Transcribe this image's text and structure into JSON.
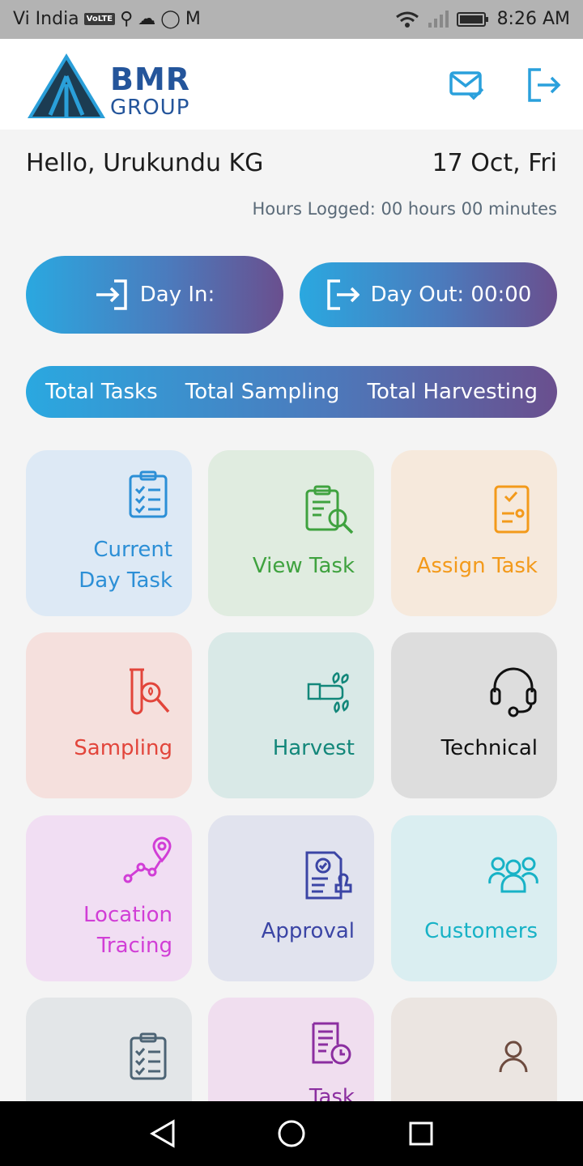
{
  "status_bar": {
    "carrier": "Vi India",
    "volte": "VoLTE",
    "time": "8:26 AM"
  },
  "header": {
    "logo_line1": "BMR",
    "logo_line2": "GROUP"
  },
  "greeting": "Hello, Urukundu KG",
  "date": "17 Oct, Fri",
  "hours_logged": "Hours Logged: 00 hours 00 minutes",
  "day_in_label": "Day In:",
  "day_out_label": "Day Out: 00:00",
  "totals": {
    "tasks": "Total Tasks",
    "sampling": "Total Sampling",
    "harvesting": "Total Harvesting"
  },
  "tiles": [
    {
      "line1": "Current",
      "line2": "Day Task",
      "bg": "#dde9f5",
      "color": "#2c8fd6",
      "icon": "clipboard-checklist-icon"
    },
    {
      "line1": "View Task",
      "bg": "#e0ece0",
      "color": "#3fa23f",
      "icon": "clipboard-search-icon"
    },
    {
      "line1": "Assign Task",
      "bg": "#f6e9dc",
      "color": "#f39a1b",
      "icon": "assign-document-icon"
    },
    {
      "line1": "Sampling",
      "bg": "#f5e0dd",
      "color": "#e2453b",
      "icon": "test-tube-search-icon"
    },
    {
      "line1": "Harvest",
      "bg": "#d9e9e7",
      "color": "#13877a",
      "icon": "harvest-hand-icon"
    },
    {
      "line1": "Technical",
      "bg": "#dddddd",
      "color": "#111111",
      "icon": "headset-icon"
    },
    {
      "line1": "Location",
      "line2": "Tracing",
      "bg": "#f1def3",
      "color": "#d13ed6",
      "icon": "location-route-icon"
    },
    {
      "line1": "Approval",
      "bg": "#e1e3ee",
      "color": "#3b45a5",
      "icon": "approval-stamp-icon"
    },
    {
      "line1": "Customers",
      "bg": "#daeef1",
      "color": "#17b2c6",
      "icon": "customers-group-icon"
    },
    {
      "bg": "#e3e6e8",
      "color": "#4d6475",
      "icon": "checklist-icon"
    },
    {
      "line1": "Task",
      "bg": "#f0deef",
      "color": "#8b2ea0",
      "icon": "task-history-icon"
    },
    {
      "bg": "#ebe5e1",
      "color": "#6d4b3f",
      "icon": "user-profile-icon"
    }
  ]
}
